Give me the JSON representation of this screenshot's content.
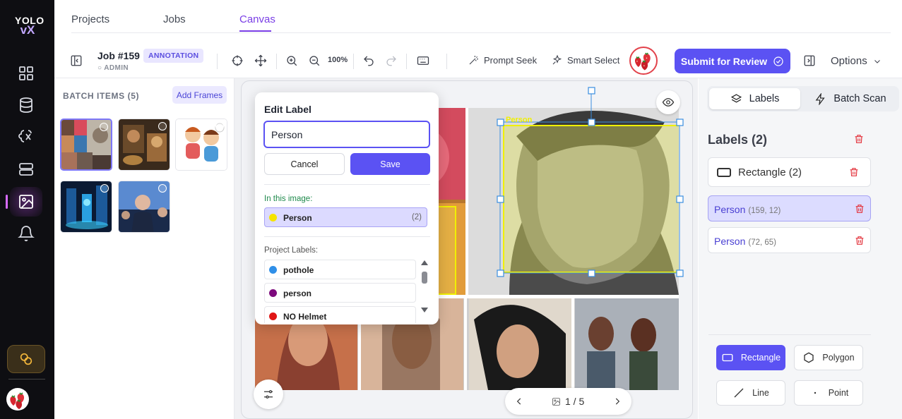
{
  "logo": {
    "line1": "YOLO",
    "line2": "vX"
  },
  "rail": {
    "items": [
      "dashboard-icon",
      "database-icon",
      "model-icon",
      "server-icon",
      "image-icon",
      "bell-icon"
    ],
    "credit_icon": "credits-icon",
    "active": "image-icon"
  },
  "top_tabs": [
    {
      "label": "Projects"
    },
    {
      "label": "Jobs"
    },
    {
      "label": "Canvas",
      "active": true
    }
  ],
  "toolbar": {
    "job_title": "Job #159",
    "job_badge": "ANNOTATION",
    "job_user": "ADMIN",
    "zoom": "100%",
    "prompt_seek": "Prompt Seek",
    "smart_select": "Smart Select",
    "submit": "Submit for Review",
    "options": "Options"
  },
  "batch": {
    "title": "BATCH ITEMS (5)",
    "add_frames": "Add Frames",
    "selected_index": 0,
    "count": 5
  },
  "canvas": {
    "box_label": "Person",
    "pager": "1 / 5"
  },
  "edit_label": {
    "title": "Edit Label",
    "value": "Person",
    "cancel": "Cancel",
    "save": "Save",
    "in_image_title": "In this image:",
    "in_image": [
      {
        "name": "Person",
        "count": "(2)",
        "color": "#f5e400"
      }
    ],
    "project_title": "Project Labels:",
    "project_labels": [
      {
        "name": "pothole",
        "color": "#2f8fe8"
      },
      {
        "name": "person",
        "color": "#7d0a7d"
      },
      {
        "name": "NO Helmet",
        "color": "#e01515"
      }
    ]
  },
  "right_panel": {
    "tabs": [
      {
        "label": "Labels",
        "active": true
      },
      {
        "label": "Batch Scan"
      }
    ],
    "labels_title": "Labels (2)",
    "group": "Rectangle (2)",
    "items": [
      {
        "name": "Person",
        "coords": "(159, 12)",
        "active": true
      },
      {
        "name": "Person",
        "coords": "(72, 65)"
      }
    ],
    "shapes": [
      {
        "label": "Rectangle",
        "active": true
      },
      {
        "label": "Polygon"
      },
      {
        "label": "Line"
      },
      {
        "label": "Point"
      }
    ]
  },
  "colors": {
    "accent": "#5b52f3",
    "tab_active": "#7a3ee6",
    "box": "#f0f000",
    "delete": "#e3333c"
  }
}
